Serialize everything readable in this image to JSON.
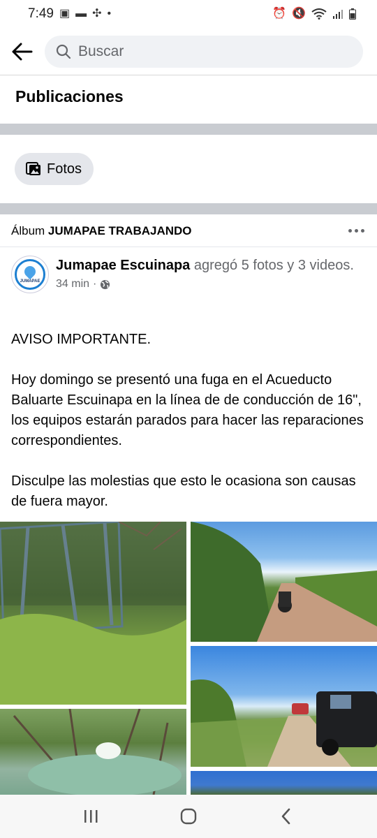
{
  "status_bar": {
    "time": "7:49"
  },
  "header": {
    "search_placeholder": "Buscar"
  },
  "section": {
    "title": "Publicaciones"
  },
  "filter": {
    "chip_label": "Fotos"
  },
  "album": {
    "prefix": "Álbum",
    "name": "JUMAPAE TRABAJANDO"
  },
  "post": {
    "author": "Jumapae Escuinapa",
    "action": " agregó 5 fotos y 3 videos.",
    "time": "34 min",
    "avatar_text": "JUMAPAE",
    "paragraphs": [
      "AVISO IMPORTANTE.",
      "Hoy domingo se presentó una fuga en el Acueducto Baluarte Escuinapa en la línea de de conducción de 16\", los equipos estarán parados para hacer las reparaciones correspondientes.",
      "Disculpe las molestias que esto le ocasiona son causas de fuera mayor."
    ]
  },
  "icons": {
    "back": "arrow-left-icon",
    "search": "search-icon",
    "photos": "photos-icon",
    "more": "more-dots-icon",
    "globe": "globe-icon",
    "nav": [
      "recent-apps-icon",
      "home-icon",
      "back-nav-icon"
    ]
  },
  "colors": {
    "accent": "#1877f2",
    "secondary_text": "#65676b",
    "divider": "#c9ccd1"
  }
}
